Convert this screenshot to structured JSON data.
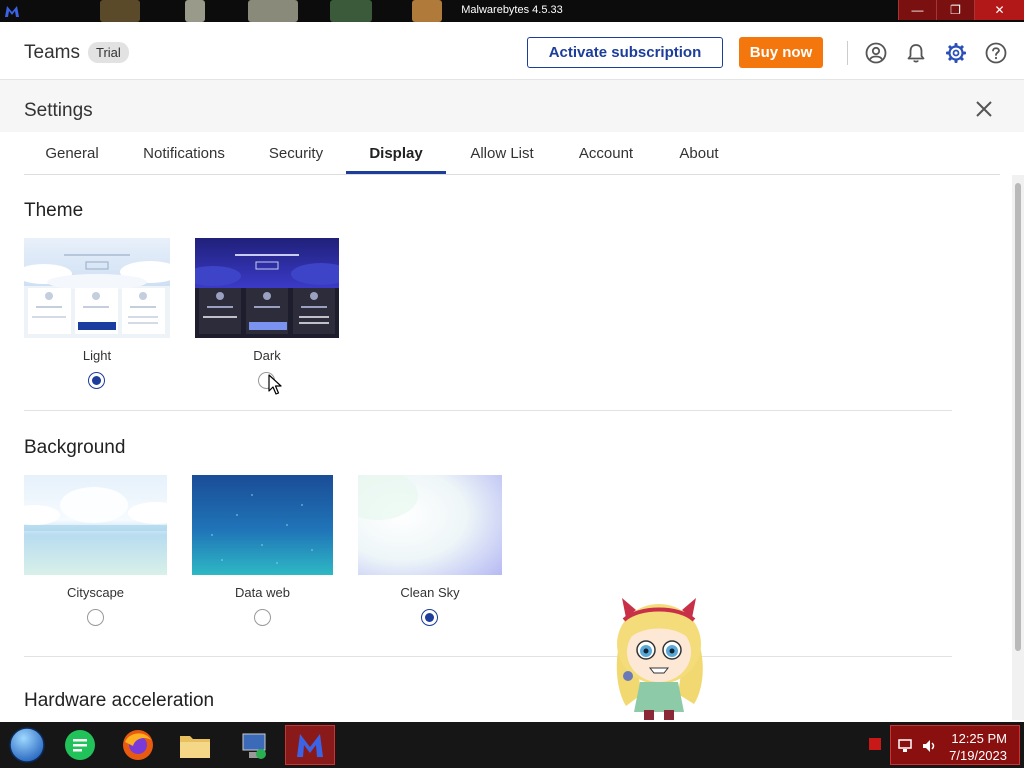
{
  "window": {
    "title": "Malwarebytes 4.5.33",
    "min_glyph": "—",
    "max_glyph": "❐",
    "close_glyph": "✕"
  },
  "header": {
    "brand": "Teams",
    "badge": "Trial",
    "activate_label": "Activate subscription",
    "buy_label": "Buy now",
    "icons": [
      "account-icon",
      "bell-icon",
      "gear-icon",
      "help-icon"
    ]
  },
  "settings": {
    "title": "Settings",
    "tabs": [
      {
        "label": "General"
      },
      {
        "label": "Notifications"
      },
      {
        "label": "Security"
      },
      {
        "label": "Display"
      },
      {
        "label": "Allow List"
      },
      {
        "label": "Account"
      },
      {
        "label": "About"
      }
    ],
    "active_tab": "Display"
  },
  "theme": {
    "title": "Theme",
    "options": [
      {
        "label": "Light",
        "selected": true
      },
      {
        "label": "Dark",
        "selected": false
      }
    ]
  },
  "background": {
    "title": "Background",
    "options": [
      {
        "label": "Cityscape",
        "selected": false
      },
      {
        "label": "Data web",
        "selected": false
      },
      {
        "label": "Clean Sky",
        "selected": true
      }
    ]
  },
  "hardware": {
    "title": "Hardware acceleration"
  },
  "taskbar": {
    "time": "12:25 PM",
    "date": "7/19/2023"
  },
  "colors": {
    "accent": "#1c3d9a",
    "buy": "#f3770d",
    "taskbar_active": "#8a1a1a"
  }
}
